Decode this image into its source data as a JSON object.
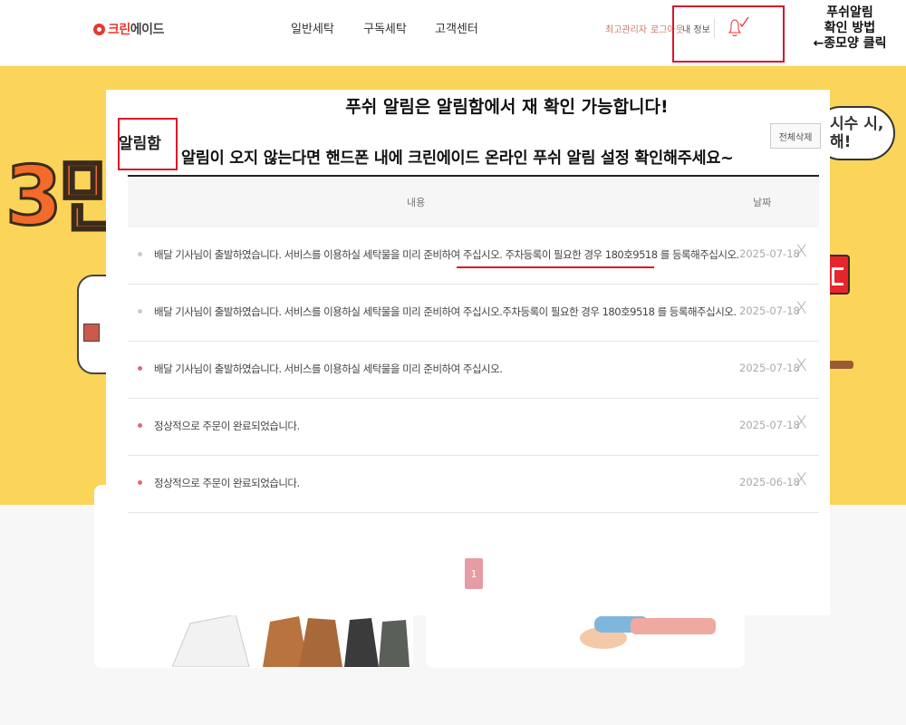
{
  "header": {
    "logo_red": "크린",
    "logo_dark": "에이드",
    "nav": [
      "일반세탁",
      "구독세탁",
      "고객센터"
    ],
    "top_links": [
      "최고관리자",
      "로그아웃"
    ],
    "my_info": "내 정보",
    "bell_icon": "bell-icon"
  },
  "instruction": {
    "line1": "푸쉬알림",
    "line2": "확인 방법",
    "line3": "←종모양 클릭"
  },
  "banner": {
    "big_text": "3만",
    "bubble_line1": "시수 시,",
    "bubble_line2": "해!"
  },
  "modal": {
    "title": "알림함",
    "delete_all": "전체삭제",
    "annotation_1": "푸쉬 알림은 알림함에서 재 확인 가능합니다!",
    "annotation_2": "알림이 오지 않는다면 핸드폰 내에 크린에이드 온라인 푸쉬 알림 설정 확인해주세요~",
    "columns": {
      "content": "내용",
      "date": "날짜"
    },
    "rows": [
      {
        "message": "배달 기사님이 출발하였습니다. 서비스를 이용하실 세탁물을 미리 준비하여 주십시오. 주차등록이 필요한 경우 180호9518 를 등록해주십시오.",
        "date": "2025-07-18",
        "read": true
      },
      {
        "message": "배달 기사님이 출발하였습니다. 서비스를 이용하실 세탁물을 미리 준비하여 주십시오.주차등록이 필요한 경우 180호9518 를 등록해주십시오.",
        "date": "2025-07-18",
        "read": true
      },
      {
        "message": "배달 기사님이 출발하였습니다. 서비스를 이용하실 세탁물을 미리 준비하여 주십시오.",
        "date": "2025-07-18",
        "read": false
      },
      {
        "message": "정상적으로 주문이 완료되었습니다.",
        "date": "2025-07-18",
        "read": false
      },
      {
        "message": "정상적으로 주문이 완료되었습니다.",
        "date": "2025-06-18",
        "read": false
      }
    ],
    "delete_symbol": "X",
    "page": "1"
  },
  "colors": {
    "brand_red": "#e8372f",
    "banner_yellow": "#fbd45a",
    "annotation_red": "#d8192b",
    "unread_dot": "#e06a78",
    "read_dot": "#cccccc",
    "page_active": "#e79ca3"
  }
}
